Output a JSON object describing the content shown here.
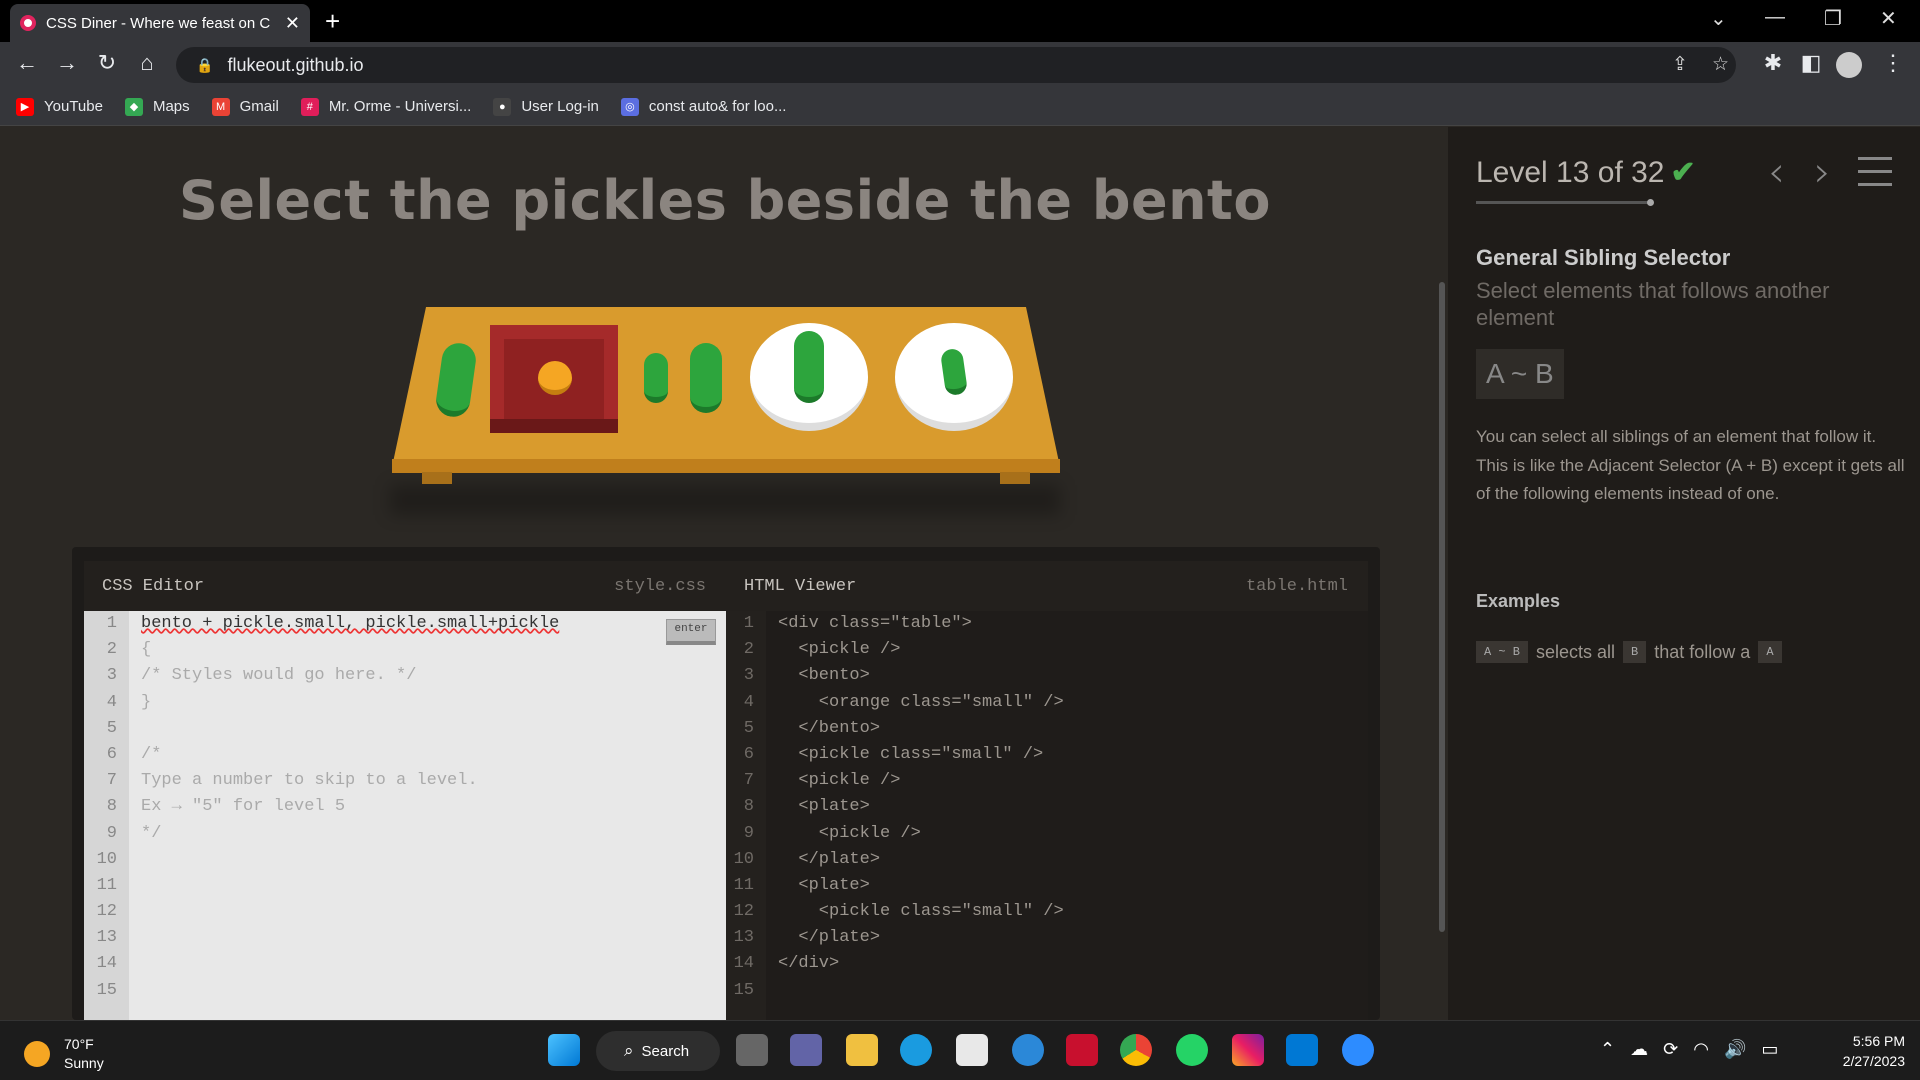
{
  "browser": {
    "tab_title": "CSS Diner - Where we feast on C",
    "tab_close": "✕",
    "new_tab": "+",
    "url": "flukeout.github.io",
    "bookmarks": [
      {
        "label": "YouTube",
        "color": "#ff0000",
        "icon": "▶"
      },
      {
        "label": "Maps",
        "color": "#34a853",
        "icon": "◆"
      },
      {
        "label": "Gmail",
        "color": "#ea4335",
        "icon": "M"
      },
      {
        "label": "Mr. Orme - Universi...",
        "color": "#e01e5a",
        "icon": "#"
      },
      {
        "label": "User Log-in",
        "color": "#444444",
        "icon": "●"
      },
      {
        "label": "const auto& for loo...",
        "color": "#5b6ee1",
        "icon": "◎"
      }
    ]
  },
  "game": {
    "instruction": "Select the pickles beside the bento"
  },
  "css_editor": {
    "title": "CSS Editor",
    "filename": "style.css",
    "input_value": "bento + pickle.small, pickle.small+pickle",
    "lines": [
      "{",
      "/* Styles would go here. */",
      "}",
      "",
      "/*",
      "Type a number to skip to a level.",
      "Ex → \"5\" for level 5",
      "*/"
    ],
    "enter_label": "enter",
    "line_count": 15
  },
  "html_viewer": {
    "title": "HTML Viewer",
    "filename": "table.html",
    "lines": [
      "<div class=\"table\">",
      "  <pickle />",
      "  <bento>",
      "    <orange class=\"small\" />",
      "  </bento>",
      "  <pickle class=\"small\" />",
      "  <pickle />",
      "  <plate>",
      "    <pickle />",
      "  </plate>",
      "  <plate>",
      "    <pickle class=\"small\" />",
      "  </plate>",
      "</div>",
      ""
    ]
  },
  "sidebar": {
    "level_text": "Level 13 of 32",
    "check": "✔",
    "selector_name": "General Sibling Selector",
    "selector_title": "Select elements that follows another element",
    "syntax": "A ~ B",
    "hint": "You can select all siblings of an element that follow it. This is like the Adjacent Selector (A + B) except it gets all of the following elements instead of one.",
    "examples_title": "Examples",
    "example": {
      "code": "A ~ B",
      "text1": "selects all",
      "code_b": "B",
      "text2": "that follow a",
      "code_a": "A"
    }
  },
  "taskbar": {
    "weather_temp": "70°F",
    "weather_desc": "Sunny",
    "search_label": "Search",
    "time": "5:56 PM",
    "date": "2/27/2023"
  }
}
